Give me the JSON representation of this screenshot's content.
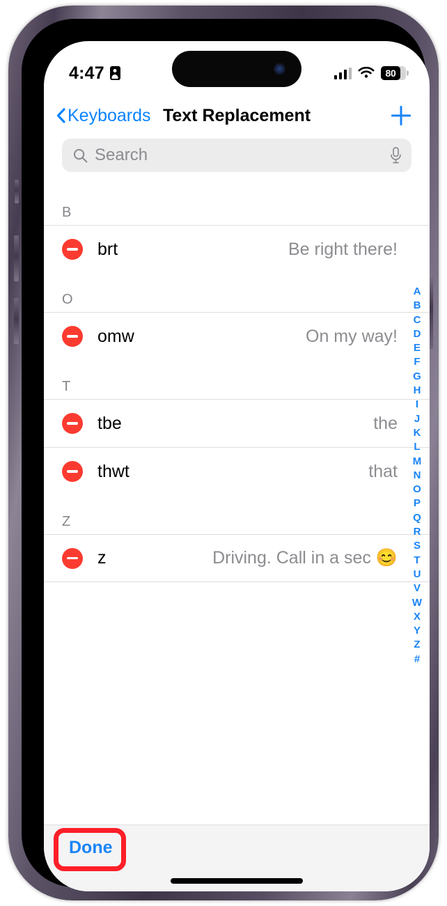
{
  "status_bar": {
    "time": "4:47",
    "id_icon": "person-badge-icon",
    "signal_icon": "cellular-signal-icon",
    "wifi_icon": "wifi-icon",
    "battery_percent": "80",
    "battery_icon": "battery-icon"
  },
  "nav_bar": {
    "back_label": "Keyboards",
    "back_icon": "chevron-left-icon",
    "title": "Text Replacement",
    "add_icon": "plus-icon"
  },
  "search": {
    "placeholder": "Search",
    "search_icon": "search-icon",
    "mic_icon": "microphone-icon"
  },
  "list": {
    "sections": [
      {
        "letter": "B",
        "rows": [
          {
            "delete_icon": "minus-circle-icon",
            "shortcut": "brt",
            "phrase": "Be right there!"
          }
        ]
      },
      {
        "letter": "O",
        "rows": [
          {
            "delete_icon": "minus-circle-icon",
            "shortcut": "omw",
            "phrase": "On my way!"
          }
        ]
      },
      {
        "letter": "T",
        "rows": [
          {
            "delete_icon": "minus-circle-icon",
            "shortcut": "tbe",
            "phrase": "the"
          },
          {
            "delete_icon": "minus-circle-icon",
            "shortcut": "thwt",
            "phrase": "that"
          }
        ]
      },
      {
        "letter": "Z",
        "rows": [
          {
            "delete_icon": "minus-circle-icon",
            "shortcut": "z",
            "phrase": "Driving. Call in a sec 😊"
          }
        ]
      }
    ]
  },
  "alpha_index": {
    "letters": [
      "A",
      "B",
      "C",
      "D",
      "E",
      "F",
      "G",
      "H",
      "I",
      "J",
      "K",
      "L",
      "M",
      "N",
      "O",
      "P",
      "Q",
      "R",
      "S",
      "T",
      "U",
      "V",
      "W",
      "X",
      "Y",
      "Z",
      "#"
    ]
  },
  "toolbar": {
    "done_label": "Done"
  },
  "colors": {
    "accent_blue": "#1a84f5",
    "link_blue": "#0a84ff",
    "delete_red": "#fc3b30",
    "highlight_red": "#fc1f28",
    "secondary_text": "#8c8c91",
    "separator": "#dededf",
    "search_bg": "#ececed",
    "toolbar_bg": "#f4f4f5"
  }
}
